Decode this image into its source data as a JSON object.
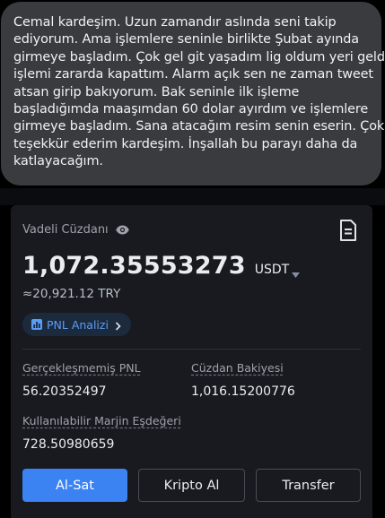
{
  "message": {
    "lines": [
      "Cemal kardeşim. Uzun zamandır aslında seni takip",
      "ediyorum. Ama işlemlere seninle birlikte Şubat ayında",
      "girmeye başladım. Çok gel git yaşadım lig oldum yeri geldi",
      "işlemi zararda kapattım. Alarm açık sen ne zaman tweet",
      "atsan girip bakıyorum. Bak seninle ilk işleme",
      "başladığımda maaşımdan 60 dolar ayırdım ve işlemlere",
      "girmeye başladım. Sana atacağım resim senin eserin. Çok",
      "teşekkür ederim kardeşim. İnşallah bu parayı daha da",
      "katlayacağım."
    ]
  },
  "wallet": {
    "title": "Vadeli Cüzdanı",
    "balance": "1,072.35553273",
    "currency": "USDT",
    "approx_try": "≈20,921.12 TRY",
    "pnl_button": "PNL Analizi",
    "unrealized_pnl_label": "Gerçekleşmemiş PNL",
    "unrealized_pnl_value": "56.20352497",
    "wallet_balance_label": "Cüzdan Bakiyesi",
    "wallet_balance_value": "1,016.15200776",
    "margin_label": "Kullanılabilir Marjin Eşdeğeri",
    "margin_value": "728.50980659"
  },
  "actions": {
    "trade": "Al-Sat",
    "buy_crypto": "Kripto Al",
    "transfer": "Transfer"
  },
  "icons": {
    "visibility": "eye-icon",
    "statement": "document-icon",
    "currency_dropdown": "caret-down-icon",
    "pnl": "bar-chart-icon",
    "pnl_arrow": "chevron-right-icon"
  },
  "colors": {
    "bubble_bg": "#3a3b3f",
    "card_bg": "#181a20",
    "accent_blue": "#3b82f2",
    "pill_bg": "#1c2a3d",
    "pill_text": "#5b9df5"
  }
}
